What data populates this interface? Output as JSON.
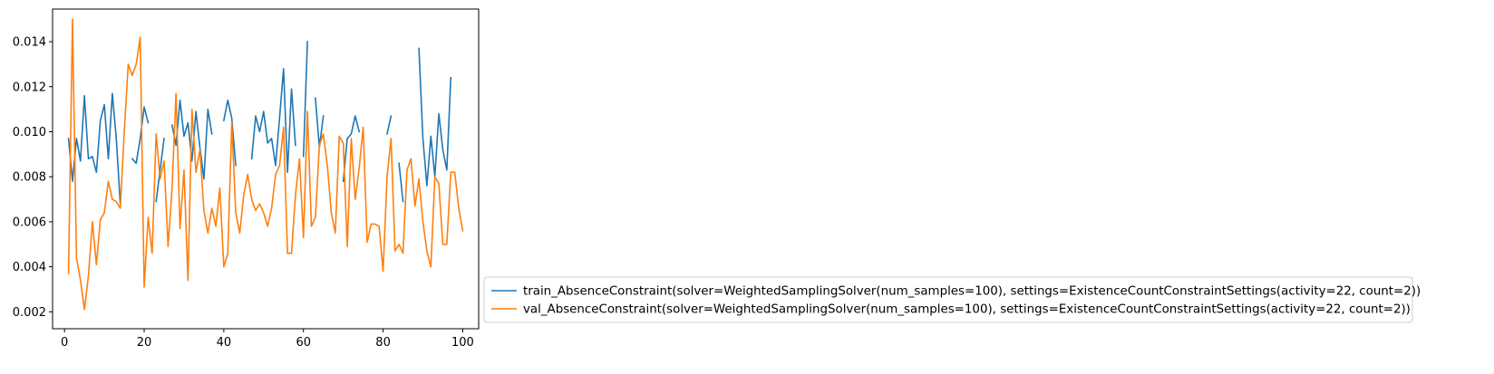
{
  "chart_data": {
    "type": "line",
    "x": [
      1,
      2,
      3,
      4,
      5,
      6,
      7,
      8,
      9,
      10,
      11,
      12,
      13,
      14,
      15,
      16,
      17,
      18,
      19,
      20,
      21,
      22,
      23,
      24,
      25,
      26,
      27,
      28,
      29,
      30,
      31,
      32,
      33,
      34,
      35,
      36,
      37,
      38,
      39,
      40,
      41,
      42,
      43,
      44,
      45,
      46,
      47,
      48,
      49,
      50,
      51,
      52,
      53,
      54,
      55,
      56,
      57,
      58,
      59,
      60,
      61,
      62,
      63,
      64,
      65,
      66,
      67,
      68,
      69,
      70,
      71,
      72,
      73,
      74,
      75,
      76,
      77,
      78,
      79,
      80,
      81,
      82,
      83,
      84,
      85,
      86,
      87,
      88,
      89,
      90,
      91,
      92,
      93,
      94,
      95,
      96,
      97,
      98,
      99,
      100
    ],
    "series": [
      {
        "name": "train_AbsenceConstraint(solver=WeightedSamplingSolver(num_samples=100), settings=ExistenceCountConstraintSettings(activity=22, count=2))",
        "color": "#1f77b4",
        "values": [
          0.0097,
          0.0078,
          0.0097,
          0.0087,
          0.0116,
          0.0088,
          0.0089,
          0.0082,
          0.0105,
          0.0112,
          0.0088,
          0.0117,
          0.0097,
          0.0068,
          null,
          null,
          0.0088,
          0.0086,
          0.0097,
          0.0111,
          0.0104,
          null,
          0.0069,
          0.0083,
          0.0097,
          null,
          0.0103,
          0.0094,
          0.0114,
          0.0098,
          0.0104,
          0.0087,
          0.0109,
          0.0093,
          0.0079,
          0.011,
          0.0099,
          null,
          null,
          0.0105,
          0.0114,
          0.0106,
          0.0085,
          null,
          null,
          null,
          0.0088,
          0.0107,
          0.01,
          0.0109,
          0.0095,
          0.0097,
          0.0085,
          0.0106,
          0.0128,
          0.0082,
          0.0119,
          0.0094,
          null,
          0.0089,
          0.014,
          null,
          0.0115,
          0.0093,
          0.0107,
          null,
          null,
          null,
          null,
          0.0078,
          0.0097,
          0.0099,
          0.0107,
          0.01,
          null,
          null,
          null,
          null,
          null,
          null,
          0.0099,
          0.0107,
          null,
          0.0086,
          0.0069,
          null,
          null,
          null,
          0.0137,
          0.0097,
          0.0076,
          0.0098,
          0.008,
          0.0108,
          0.0092,
          0.0083,
          0.0124,
          null,
          null,
          null
        ]
      },
      {
        "name": "val_AbsenceConstraint(solver=WeightedSamplingSolver(num_samples=100), settings=ExistenceCountConstraintSettings(activity=22, count=2))",
        "color": "#ff7f0e",
        "values": [
          0.0037,
          0.015,
          0.0044,
          0.0034,
          0.0021,
          0.0036,
          0.006,
          0.0041,
          0.0061,
          0.0064,
          0.0078,
          0.007,
          0.0069,
          0.0066,
          0.01,
          0.013,
          0.0125,
          0.013,
          0.0142,
          0.0031,
          0.0062,
          0.0046,
          0.0099,
          0.0079,
          0.0087,
          0.0049,
          0.0075,
          0.0117,
          0.0057,
          0.0083,
          0.0034,
          0.011,
          0.0082,
          0.0092,
          0.0065,
          0.0055,
          0.0066,
          0.0058,
          0.0075,
          0.004,
          0.0046,
          0.0104,
          0.0064,
          0.0055,
          0.0072,
          0.0081,
          0.007,
          0.0065,
          0.0068,
          0.0064,
          0.0058,
          0.0066,
          0.0081,
          0.0085,
          0.0102,
          0.0046,
          0.0046,
          0.0072,
          0.0088,
          0.0053,
          0.0109,
          0.0058,
          0.0062,
          0.0094,
          0.0099,
          0.0085,
          0.0064,
          0.0055,
          0.0098,
          0.0095,
          0.0049,
          0.0097,
          0.007,
          0.0084,
          0.0102,
          0.0051,
          0.0059,
          0.0059,
          0.0058,
          0.0038,
          0.008,
          0.0097,
          0.0047,
          0.005,
          0.0046,
          0.0083,
          0.0088,
          0.0067,
          0.0079,
          0.006,
          0.0047,
          0.004,
          0.008,
          0.0077,
          0.005,
          0.005,
          0.0082,
          0.0082,
          0.0066,
          0.0056
        ]
      }
    ],
    "xlim": [
      -3,
      104
    ],
    "ylim": [
      0.00125,
      0.01545
    ],
    "xticks": [
      0,
      20,
      40,
      60,
      80,
      100
    ],
    "yticks": [
      0.002,
      0.004,
      0.006,
      0.008,
      0.01,
      0.012,
      0.014
    ],
    "xtick_labels": [
      "0",
      "20",
      "40",
      "60",
      "80",
      "100"
    ],
    "ytick_labels": [
      "0.002",
      "0.004",
      "0.006",
      "0.008",
      "0.010",
      "0.012",
      "0.014"
    ],
    "title": "",
    "xlabel": "",
    "ylabel": "",
    "grid": false,
    "legend_position": "outside-lower-right"
  }
}
